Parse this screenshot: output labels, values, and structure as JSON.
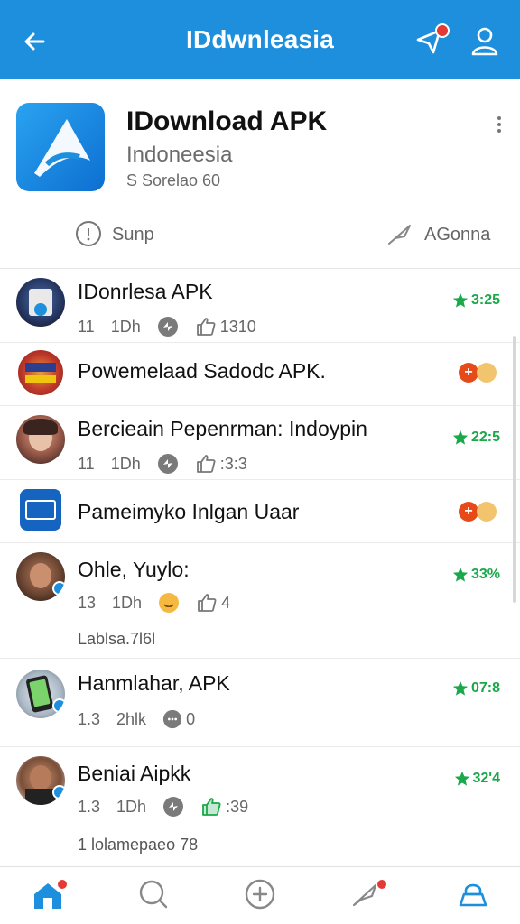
{
  "header": {
    "title": "IDdwnleasia",
    "notification_badge": true
  },
  "app": {
    "name": "IDownload APK",
    "subtitle": "Indoneesia",
    "meta": "S Sorelao 60",
    "left_action_label": "Sunp",
    "right_action_label": "AGonna"
  },
  "feed": [
    {
      "title": "IDonrlesa APK",
      "stat1": "11",
      "stat2": "1Dh",
      "likes": "1310",
      "score": "3:25",
      "has_stats": true
    },
    {
      "title": "Powemelaad Sadodc APK.",
      "has_stats": false,
      "pair_symbol": "+"
    },
    {
      "title": "Bercieain Pepenrman: Indoypin",
      "stat1": "11",
      "stat2": "1Dh",
      "likes": ":3:3",
      "score": "22:5",
      "has_stats": true
    },
    {
      "title": "Pameimyko Inlgan Uaar",
      "has_stats": false,
      "pair_symbol": "+"
    },
    {
      "title": "Ohle, Yuylo:",
      "stat1": "13",
      "stat2": "1Dh",
      "likes": "4",
      "score": "33%",
      "extra": "Lablsa.7l6l",
      "has_stats": true
    },
    {
      "title": "Hanmlahar, APK",
      "stat1": "1.3",
      "stat2": "2hlk",
      "comments": "0",
      "score": "07:8",
      "has_stats": true
    },
    {
      "title": "Beniai Aipkk",
      "stat1": "1.3",
      "stat2": "1Dh",
      "likes": ":39",
      "score": "32'4",
      "extra": "1 lolamepaeo  78",
      "has_stats": true
    }
  ],
  "colors": {
    "primary": "#1e8fdc",
    "score_green": "#19a84a",
    "accent_red": "#e53935"
  }
}
